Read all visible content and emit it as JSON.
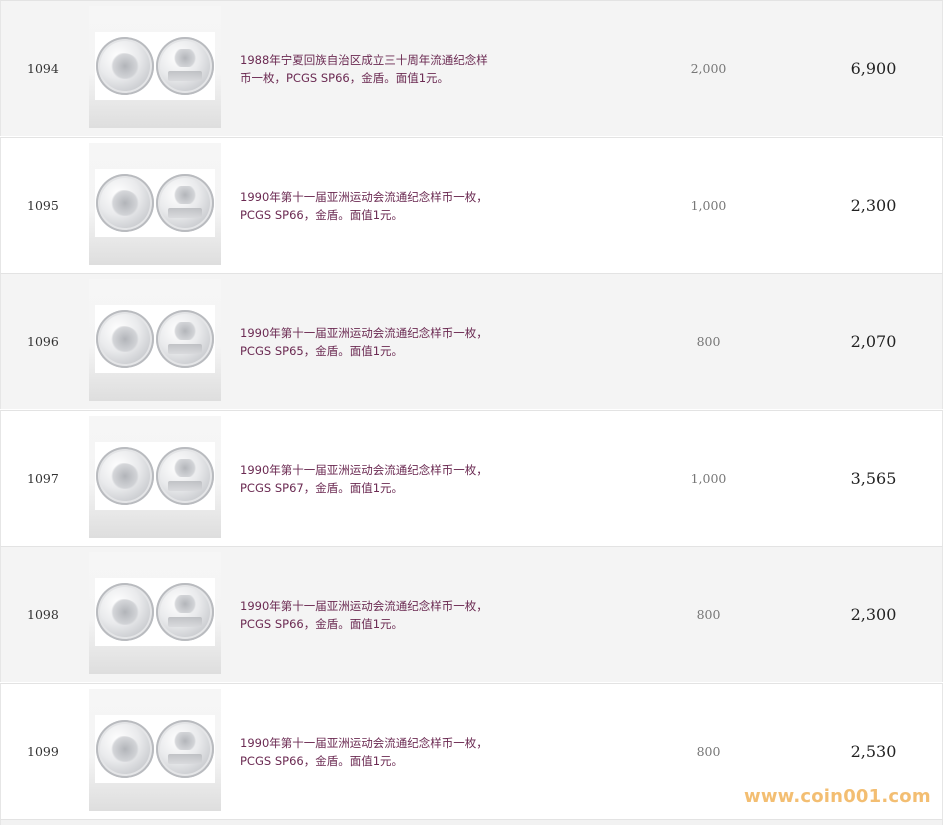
{
  "rows": [
    {
      "lot": "1094",
      "desc_line1": "1988年宁夏回族自治区成立三十周年流通纪念样",
      "desc_line2": "币一枚，PCGS SP66，金盾。面值1元。",
      "estimate": "2,000",
      "price": "6,900"
    },
    {
      "lot": "1095",
      "desc_line1": "1990年第十一届亚洲运动会流通纪念样币一枚，",
      "desc_line2": "PCGS SP66，金盾。面值1元。",
      "estimate": "1,000",
      "price": "2,300"
    },
    {
      "lot": "1096",
      "desc_line1": "1990年第十一届亚洲运动会流通纪念样币一枚，",
      "desc_line2": "PCGS SP65，金盾。面值1元。",
      "estimate": "800",
      "price": "2,070"
    },
    {
      "lot": "1097",
      "desc_line1": "1990年第十一届亚洲运动会流通纪念样币一枚，",
      "desc_line2": "PCGS SP67，金盾。面值1元。",
      "estimate": "1,000",
      "price": "3,565"
    },
    {
      "lot": "1098",
      "desc_line1": "1990年第十一届亚洲运动会流通纪念样币一枚，",
      "desc_line2": "PCGS SP66，金盾。面值1元。",
      "estimate": "800",
      "price": "2,300"
    },
    {
      "lot": "1099",
      "desc_line1": "1990年第十一届亚洲运动会流通纪念样币一枚，",
      "desc_line2": "PCGS SP66，金盾。面值1元。",
      "estimate": "800",
      "price": "2,530"
    }
  ],
  "watermark": "www.coin001.com",
  "colors": {
    "description_text": "#6b2a52",
    "row_alt_background": "#f4f4f4",
    "watermark": "#f1b35a"
  }
}
